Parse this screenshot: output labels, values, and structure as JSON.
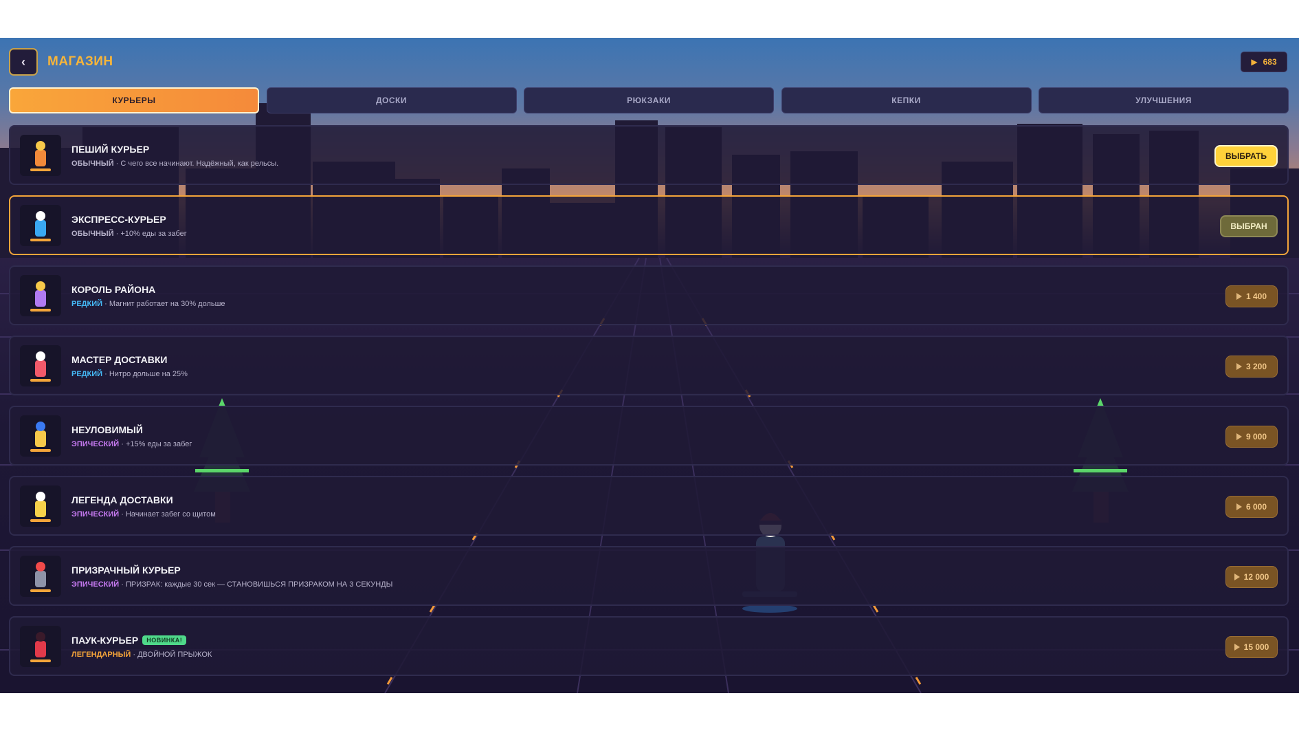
{
  "header": {
    "back_icon": "chevron-left-icon",
    "title": "МАГАЗИН",
    "coins_icon": "coin-icon",
    "coins": "683"
  },
  "tabs": [
    {
      "label": "КУРЬЕРЫ",
      "active": true
    },
    {
      "label": "ДОСКИ",
      "active": false
    },
    {
      "label": "РЮКЗАКИ",
      "active": false
    },
    {
      "label": "КЕПКИ",
      "active": false
    },
    {
      "label": "УЛУЧШЕНИЯ",
      "active": false
    }
  ],
  "couriers": [
    {
      "name": "ПЕШИЙ КУРЬЕР",
      "rarity": "ОБЫЧНЫЙ",
      "rarity_color": "#b9b4cc",
      "desc": " · С чего все начинают. Надёжный, как рельсы.",
      "button": "ВЫБРАТЬ",
      "state": "select",
      "badge": "",
      "colors": [
        "#f28a3a",
        "#f7c94a"
      ]
    },
    {
      "name": "ЭКСПРЕСС-КУРЬЕР",
      "rarity": "ОБЫЧНЫЙ",
      "rarity_color": "#b9b4cc",
      "desc": " · +10% еды за забег",
      "button": "ВЫБРАН",
      "state": "chosen",
      "badge": "",
      "colors": [
        "#3aa8f2",
        "#ffffff"
      ]
    },
    {
      "name": "КОРОЛЬ РАЙОНА",
      "rarity": "РЕДКИЙ",
      "rarity_color": "#45b8f5",
      "desc": " · Магнит работает на 30% дольше",
      "button": "1 400",
      "state": "price",
      "badge": "",
      "colors": [
        "#b07af2",
        "#f7c94a"
      ]
    },
    {
      "name": "МАСТЕР ДОСТАВКИ",
      "rarity": "РЕДКИЙ",
      "rarity_color": "#45b8f5",
      "desc": " · Нитро дольше на 25%",
      "button": "3 200",
      "state": "price",
      "badge": "",
      "colors": [
        "#f25a6a",
        "#ffffff"
      ]
    },
    {
      "name": "НЕУЛОВИМЫЙ",
      "rarity": "ЭПИЧЕСКИЙ",
      "rarity_color": "#c77af2",
      "desc": " · +15% еды за забег",
      "button": "9 000",
      "state": "price",
      "badge": "",
      "colors": [
        "#f7c94a",
        "#3a7af2"
      ]
    },
    {
      "name": "ЛЕГЕНДА ДОСТАВКИ",
      "rarity": "ЭПИЧЕСКИЙ",
      "rarity_color": "#c77af2",
      "desc": " · Начинает забег со щитом",
      "button": "6 000",
      "state": "price",
      "badge": "",
      "colors": [
        "#f7d14a",
        "#ffffff"
      ]
    },
    {
      "name": "ПРИЗРАЧНЫЙ КУРЬЕР",
      "rarity": "ЭПИЧЕСКИЙ",
      "rarity_color": "#c77af2",
      "desc": " · ПРИЗРАК: каждые 30 сек — СТАНОВИШЬСЯ ПРИЗРАКОМ НА 3 СЕКУНДЫ",
      "button": "12 000",
      "state": "price",
      "badge": "",
      "colors": [
        "#8e93a8",
        "#f24a4a"
      ]
    },
    {
      "name": "ПАУК-КУРЬЕР",
      "rarity": "ЛЕГЕНДАРНЫЙ",
      "rarity_color": "#f7a53a",
      "desc": " · ДВОЙНОЙ ПРЫЖОК",
      "button": "15 000",
      "state": "price",
      "badge": "НОВИНКА!",
      "colors": [
        "#e23a4a",
        "#3a1a2a"
      ]
    }
  ],
  "palette": {
    "accent": "#f7b53a",
    "tab_active": "#f9a63a",
    "panel": "#201a36",
    "price_button": "#7a5424",
    "select_button": "#ffd23a"
  }
}
